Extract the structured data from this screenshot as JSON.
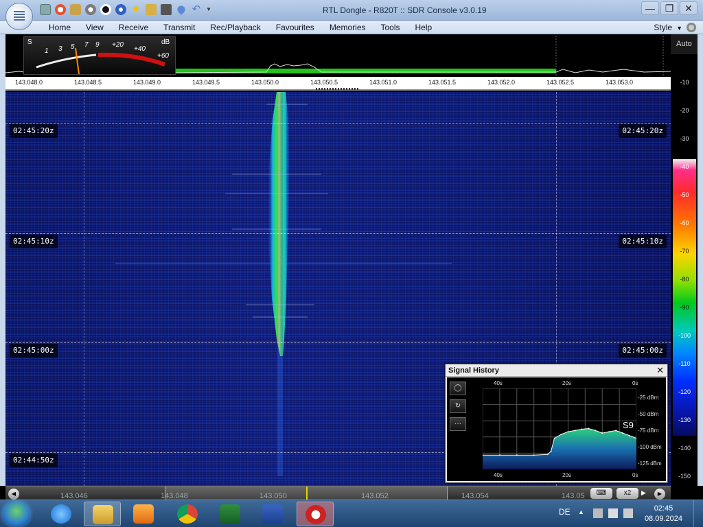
{
  "window": {
    "title": "RTL Dongle - R820T :: SDR Console v3.0.19",
    "controls": [
      "—",
      "❐",
      "✕"
    ]
  },
  "menu": {
    "items": [
      "Home",
      "View",
      "Receive",
      "Transmit",
      "Rec/Playback",
      "Favourites",
      "Memories",
      "Tools",
      "Help"
    ],
    "style_label": "Style"
  },
  "colors": {
    "accent": "#9cb6da",
    "waterfall_bg": "#0a1570",
    "signal_core": "#e6ef3a",
    "signal_edge": "#1fb8d0"
  },
  "smeter": {
    "s_label": "S",
    "s_ticks": [
      "1",
      "3",
      "5",
      "7",
      "9"
    ],
    "db_label": "dB",
    "db_ticks": [
      "+20",
      "+40",
      "+60"
    ]
  },
  "freq_axis": {
    "labels": [
      "143.048.0",
      "143.048.5",
      "143.049.0",
      "143.049.5",
      "143.050.0",
      "143.050.5",
      "143.051.0",
      "143.051.5",
      "143.052.0",
      "143.052.5",
      "143.053.0"
    ]
  },
  "db_scale": {
    "auto_label": "Auto",
    "ticks": [
      "-10",
      "-20",
      "-30",
      "-40",
      "-50",
      "-60",
      "-70",
      "-80",
      "-90",
      "-100",
      "-110",
      "-120",
      "-130",
      "-140",
      "-150"
    ]
  },
  "waterfall": {
    "times": [
      "02:45:20z",
      "02:45:10z",
      "02:45:00z",
      "02:44:50z"
    ]
  },
  "bottom": {
    "freqs": [
      "143.046",
      "143.048",
      "143.050",
      "143.052",
      "143.054",
      "143.05"
    ],
    "zoom_label": "x2"
  },
  "signal_history": {
    "title": "Signal History",
    "close": "✕",
    "x_labels": [
      "40s",
      "20s",
      "0s"
    ],
    "y_labels": [
      "-25 dBm",
      "-50 dBm",
      "-75 dBm",
      "-100 dBm",
      "-125 dBm"
    ],
    "s_level": "S9",
    "tools": [
      "◯",
      "↻",
      "···"
    ],
    "chart_data": {
      "type": "area",
      "x_unit": "seconds ago",
      "x": [
        45,
        40,
        35,
        30,
        26,
        25,
        24,
        22,
        20,
        18,
        16,
        14,
        12,
        10,
        8,
        6,
        4,
        2,
        0
      ],
      "values": [
        -118,
        -118,
        -118,
        -118,
        -117,
        -112,
        -92,
        -86,
        -82,
        -80,
        -78,
        -77,
        -80,
        -84,
        -82,
        -80,
        -84,
        -88,
        -92
      ],
      "xlabel": "",
      "ylabel": "",
      "ylim": [
        -140,
        -15
      ],
      "xlim": [
        45,
        0
      ],
      "grid": true
    }
  },
  "taskbar": {
    "apps": [
      "ie",
      "explorer",
      "media",
      "chrome",
      "excel",
      "word",
      "sdr"
    ],
    "lang": "DE",
    "time": "02:45",
    "date": "08.09.2024"
  }
}
